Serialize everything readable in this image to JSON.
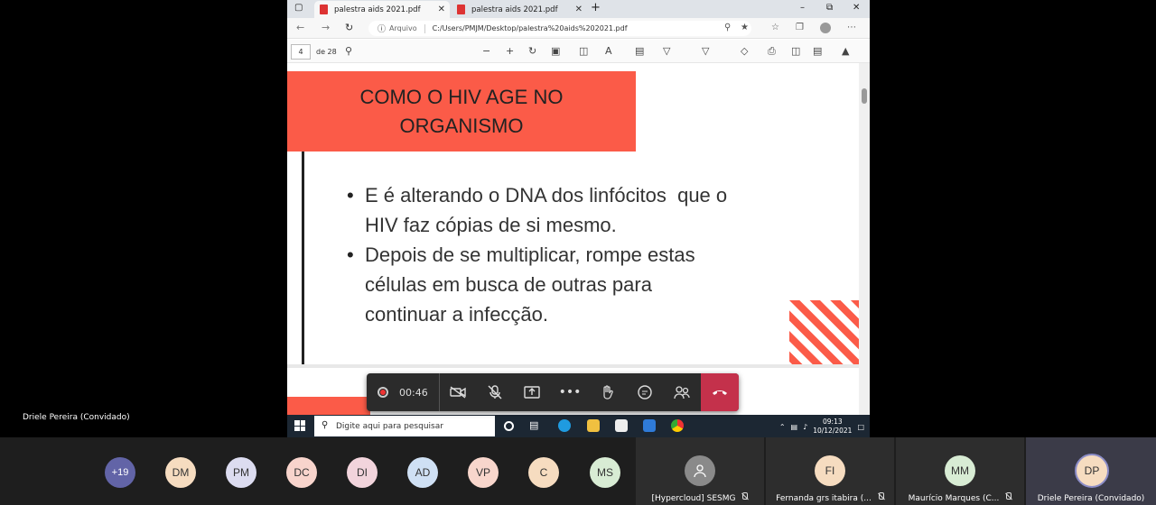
{
  "browser": {
    "tabs": [
      {
        "label": "palestra aids 2021.pdf",
        "active": true
      },
      {
        "label": "palestra aids 2021.pdf",
        "active": false
      }
    ],
    "new_tab_symbol": "+",
    "address": {
      "site_label": "Arquivo",
      "url": "C:/Users/PMJM/Desktop/palestra%20aids%202021.pdf"
    }
  },
  "pdf_toolbar": {
    "page": "4",
    "page_of": "de 28"
  },
  "slide": {
    "title": "COMO O HIV AGE NO ORGANISMO",
    "bullets": [
      "E é alterando o DNA dos linfócitos  que o HIV faz cópias de si mesmo.",
      "Depois de se multiplicar, rompe estas células em busca de outras para continuar a infecção."
    ],
    "accent_color": "#fb5b48"
  },
  "taskbar": {
    "search_placeholder": "Digite aqui para pesquisar",
    "time": "09:13",
    "date": "10/12/2021"
  },
  "meeting": {
    "recording_time": "00:46",
    "presenter_label": "Driele Pereira (Convidado)"
  },
  "participants": {
    "overflow": "+19",
    "avatars": [
      {
        "initials": "DM",
        "color": "#f6dcc0"
      },
      {
        "initials": "PM",
        "color": "#dcdcf0"
      },
      {
        "initials": "DC",
        "color": "#f8d4cc"
      },
      {
        "initials": "DI",
        "color": "#f2d4dc"
      },
      {
        "initials": "AD",
        "color": "#cfe0f4"
      },
      {
        "initials": "VP",
        "color": "#f8d6cc"
      },
      {
        "initials": "C",
        "color": "#f6dcc0"
      },
      {
        "initials": "MS",
        "color": "#d8ecd4"
      }
    ],
    "tiles": [
      {
        "name": "[Hypercloud] SESMG",
        "initials": "",
        "color": "#8a8a8a"
      },
      {
        "name": "Fernanda grs itabira (...",
        "initials": "FI",
        "color": "#f6dcc0"
      },
      {
        "name": "Maurício Marques (C...",
        "initials": "MM",
        "color": "#d8ecd4"
      },
      {
        "name": "Driele Pereira (Convidado)",
        "initials": "DP",
        "color": "#f6dcc0"
      }
    ]
  }
}
